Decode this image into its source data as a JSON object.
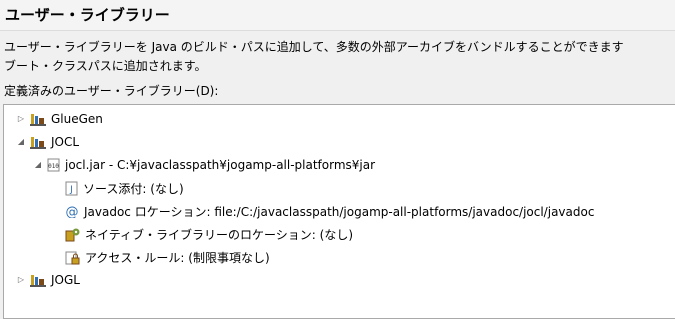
{
  "dialog": {
    "title": "ユーザー・ライブラリー",
    "description_line1": "ユーザー・ライブラリーを Java のビルド・パスに追加して、多数の外部アーカイブをバンドルすることができます",
    "description_line2": "ブート・クラスパスに追加されます。",
    "tree_label": "定義済みのユーザー・ライブラリー(D):"
  },
  "tree": {
    "gluegen": "GlueGen",
    "jocl": "JOCL",
    "jar": "jocl.jar - C:¥javaclasspath¥jogamp-all-platforms¥jar",
    "source": "ソース添付: (なし)",
    "javadoc": "Javadoc ロケーション: file:/C:/javaclasspath/jogamp-all-platforms/javadoc/jocl/javadoc",
    "native": "ネイティブ・ライブラリーのロケーション: (なし)",
    "access": "アクセス・ルール: (制限事項なし)",
    "jogl": "JOGL"
  }
}
